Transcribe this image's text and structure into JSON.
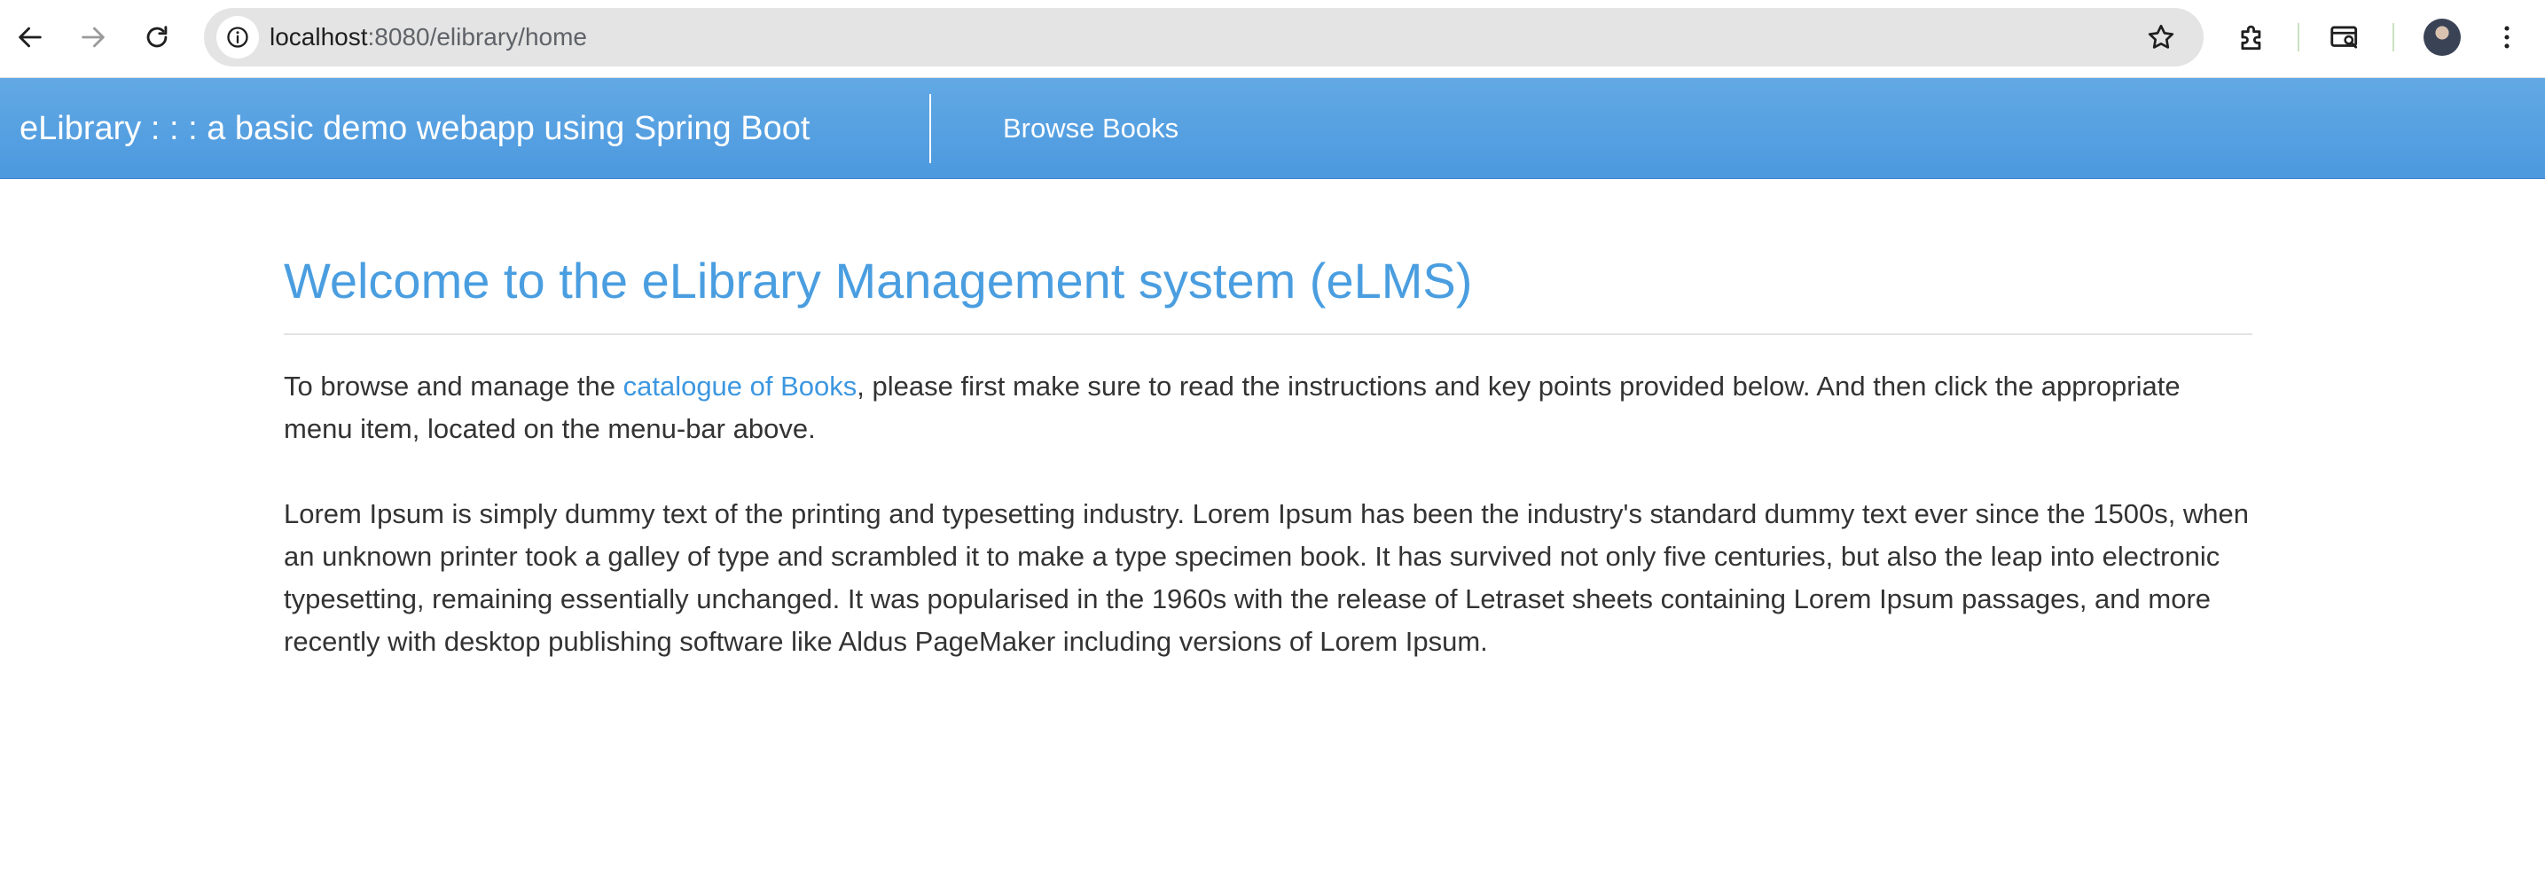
{
  "browser": {
    "url_host": "localhost",
    "url_path": ":8080/elibrary/home"
  },
  "navbar": {
    "brand": "eLibrary : : : a basic demo webapp using Spring Boot",
    "browse_link": "Browse Books"
  },
  "main": {
    "title": "Welcome to the eLibrary Management system (eLMS)",
    "intro_before": "To browse and manage the ",
    "intro_link": "catalogue of Books",
    "intro_after": ", please first make sure to read the instructions and key points provided below. And then click the appropriate menu item, located on the menu-bar above.",
    "lorem": "Lorem Ipsum is simply dummy text of the printing and typesetting industry. Lorem Ipsum has been the industry's standard dummy text ever since the 1500s, when an unknown printer took a galley of type and scrambled it to make a type specimen book. It has survived not only five centuries, but also the leap into electronic typesetting, remaining essentially unchanged. It was popularised in the 1960s with the release of Letraset sheets containing Lorem Ipsum passages, and more recently with desktop publishing software like Aldus PageMaker including versions of Lorem Ipsum."
  },
  "icons": {
    "back": "back-arrow-icon",
    "forward": "forward-arrow-icon",
    "reload": "reload-icon",
    "site_info": "info-icon",
    "bookmark": "star-icon",
    "extensions": "puzzle-icon",
    "tab_search": "tab-search-icon",
    "menu": "kebab-menu-icon"
  },
  "colors": {
    "navbar": "#4c99df",
    "accent": "#4a9ee0",
    "body_text": "#333333"
  }
}
